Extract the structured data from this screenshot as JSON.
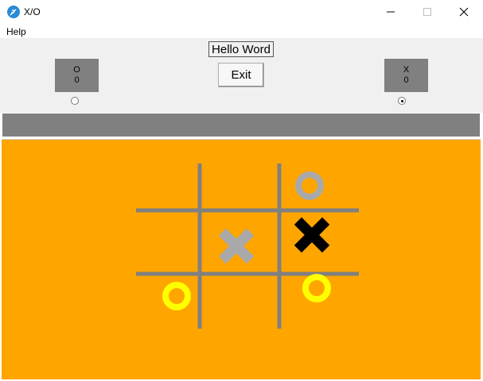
{
  "window": {
    "title": "X/O",
    "icon": "feather-icon",
    "controls": [
      "minimize",
      "maximize",
      "close"
    ]
  },
  "menu": {
    "items": [
      "Help"
    ]
  },
  "header": {
    "hello_label": "Hello Word",
    "exit_label": "Exit"
  },
  "players": {
    "o": {
      "symbol": "O",
      "score": "0",
      "selected": false
    },
    "x": {
      "symbol": "X",
      "score": "0",
      "selected": true
    }
  },
  "board": {
    "background": "#ffa500",
    "grid_color": "#808080",
    "pieces": [
      {
        "type": "O",
        "color": "#a9a9a9",
        "cell": "top-right"
      },
      {
        "type": "X",
        "color": "#000000",
        "cell": "middle-right"
      },
      {
        "type": "X",
        "color": "#a9a9a9",
        "cell": "center"
      },
      {
        "type": "O",
        "color": "#ffff00",
        "cell": "bottom-left"
      },
      {
        "type": "O",
        "color": "#ffff00",
        "cell": "bottom-right"
      }
    ]
  }
}
